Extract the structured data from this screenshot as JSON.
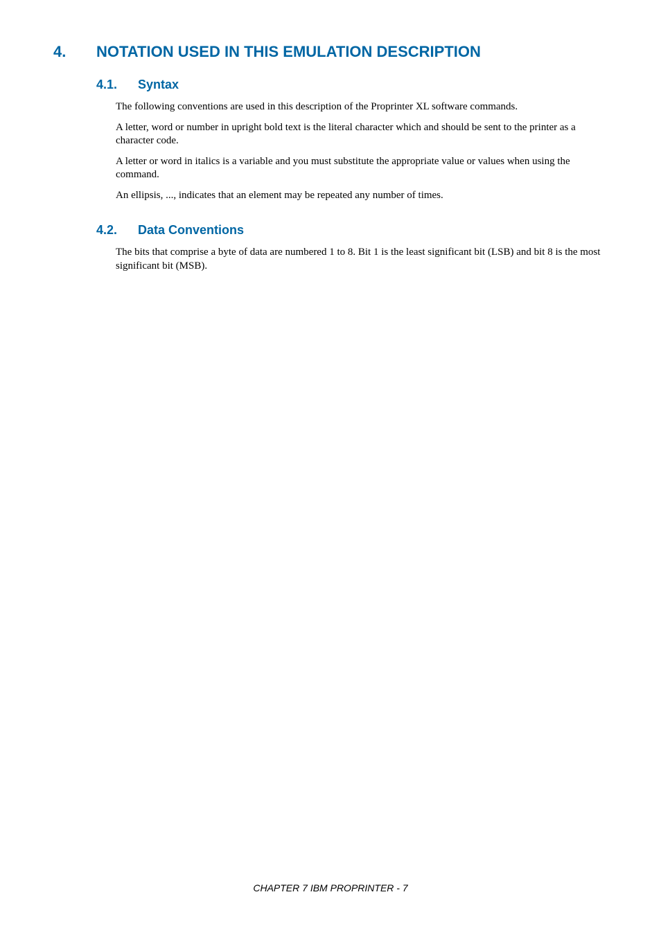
{
  "heading1": {
    "number": "4.",
    "title": "NOTATION USED IN THIS EMULATION DESCRIPTION"
  },
  "section_4_1": {
    "number": "4.1.",
    "title": "Syntax",
    "paragraphs": [
      "The following conventions are used in this description of the Proprinter XL software commands.",
      "A letter, word or number in upright bold text is the literal character which and should be sent to the printer as a character code.",
      "A letter or word in italics is a variable and you must substitute the appropriate value or values when using the command.",
      "An ellipsis, ..., indicates that an element may be repeated any number of times."
    ]
  },
  "section_4_2": {
    "number": "4.2.",
    "title": "Data Conventions",
    "paragraphs": [
      "The bits that comprise a byte of data are numbered 1 to 8.  Bit 1 is the least significant bit (LSB) and bit 8 is the most significant bit (MSB)."
    ]
  },
  "footer": "CHAPTER 7 IBM PROPRINTER - 7"
}
